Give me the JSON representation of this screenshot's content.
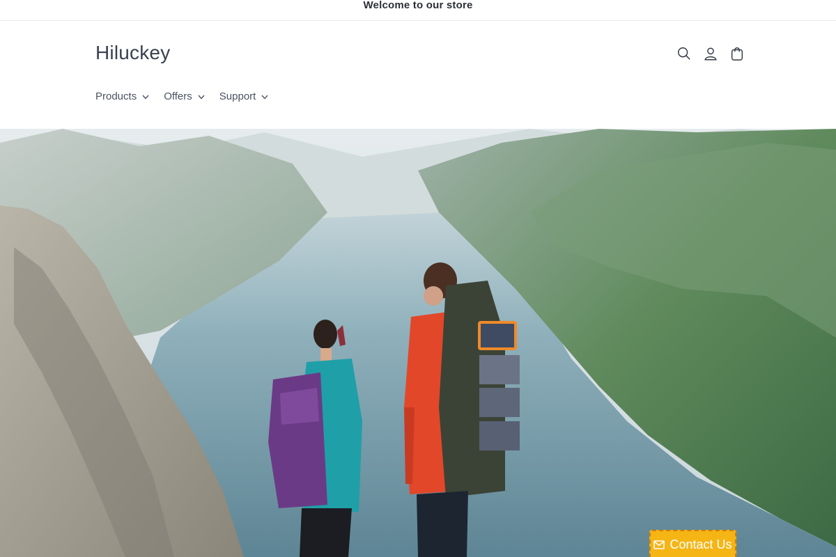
{
  "announcement": {
    "text": "Welcome to our store"
  },
  "header": {
    "logo": "Hiluckey",
    "icons": {
      "search": "search-icon",
      "account": "user-icon",
      "cart": "cart-icon"
    }
  },
  "nav": {
    "items": [
      {
        "label": "Products"
      },
      {
        "label": "Offers"
      },
      {
        "label": "Support"
      }
    ]
  },
  "hero": {
    "image": "hikers-fjord-photo"
  },
  "contact": {
    "label": "Contact Us",
    "icon": "envelope-icon",
    "color": "#f5b515"
  },
  "colors": {
    "text": "#333a44",
    "accent": "#f5b515"
  }
}
